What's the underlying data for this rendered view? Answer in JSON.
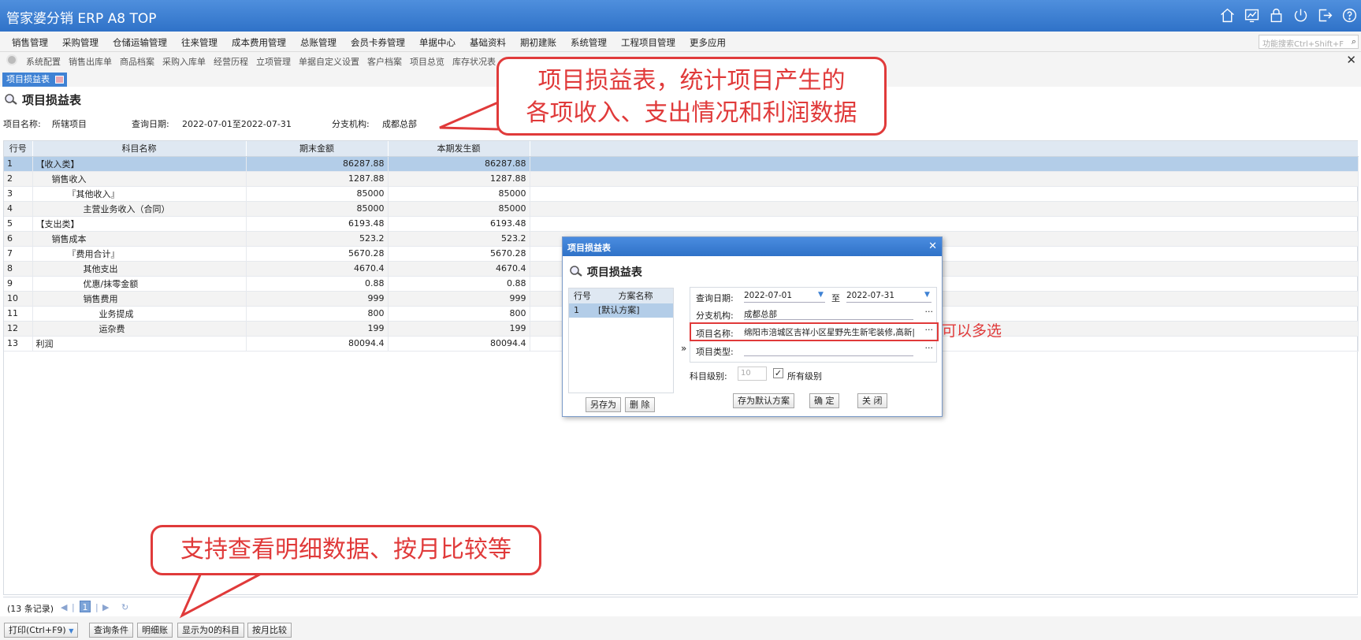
{
  "app": {
    "title": "管家婆分销 ERP A8 TOP"
  },
  "menu": [
    "销售管理",
    "采购管理",
    "仓储运输管理",
    "往来管理",
    "成本费用管理",
    "总账管理",
    "会员卡券管理",
    "单据中心",
    "基础资料",
    "期初建账",
    "系统管理",
    "工程项目管理",
    "更多应用"
  ],
  "function_search": {
    "placeholder": "功能搜索Ctrl+Shift+F"
  },
  "quick_links": [
    "系统配置",
    "销售出库单",
    "商品档案",
    "采购入库单",
    "经营历程",
    "立项管理",
    "单据自定义设置",
    "客户档案",
    "项目总览",
    "库存状况表"
  ],
  "tab": {
    "label": "项目损益表"
  },
  "page": {
    "title": "项目损益表"
  },
  "filters": {
    "project_label": "项目名称:",
    "project_value": "所辖项目",
    "date_label": "查询日期:",
    "date_value": "2022-07-01至2022-07-31",
    "branch_label": "分支机构:",
    "branch_value": "成都总部"
  },
  "table": {
    "headers": [
      "行号",
      "科目名称",
      "期末金额",
      "本期发生额"
    ],
    "rows": [
      {
        "no": "1",
        "name": "【收入类】",
        "end": "86287.88",
        "period": "86287.88"
      },
      {
        "no": "2",
        "name": "销售收入",
        "end": "1287.88",
        "period": "1287.88"
      },
      {
        "no": "3",
        "name": "『其他收入』",
        "end": "85000",
        "period": "85000"
      },
      {
        "no": "4",
        "name": "主营业务收入（合同）",
        "end": "85000",
        "period": "85000"
      },
      {
        "no": "5",
        "name": "【支出类】",
        "end": "6193.48",
        "period": "6193.48"
      },
      {
        "no": "6",
        "name": "销售成本",
        "end": "523.2",
        "period": "523.2"
      },
      {
        "no": "7",
        "name": "『费用合计』",
        "end": "5670.28",
        "period": "5670.28"
      },
      {
        "no": "8",
        "name": "其他支出",
        "end": "4670.4",
        "period": "4670.4"
      },
      {
        "no": "9",
        "name": "优惠/抹零金额",
        "end": "0.88",
        "period": "0.88"
      },
      {
        "no": "10",
        "name": "销售费用",
        "end": "999",
        "period": "999"
      },
      {
        "no": "11",
        "name": "业务提成",
        "end": "800",
        "period": "800"
      },
      {
        "no": "12",
        "name": "运杂费",
        "end": "199",
        "period": "199"
      },
      {
        "no": "13",
        "name": "利润",
        "end": "80094.4",
        "period": "80094.4"
      }
    ]
  },
  "pager": {
    "count": "(13 条记录)",
    "current_page": "1"
  },
  "bottom_buttons": {
    "print": "打印(Ctrl+F9)",
    "query": "查询条件",
    "detail": "明细账",
    "show_zero": "显示为0的科目",
    "monthly": "按月比较"
  },
  "callouts": {
    "top_line1": "项目损益表，统计项目产生的",
    "top_line2": "各项收入、支出情况和利润数据",
    "bottom": "支持查看明细数据、按月比较等",
    "multi": "可以多选"
  },
  "dialog": {
    "header": "项目损益表",
    "title": "项目损益表",
    "scheme_headers": [
      "行号",
      "方案名称"
    ],
    "scheme_rows": [
      {
        "no": "1",
        "name": "[默认方案]"
      }
    ],
    "arrow": "»",
    "date_label": "查询日期:",
    "date_from": "2022-07-01",
    "date_to_sep": "至",
    "date_to": "2022-07-31",
    "branch_label": "分支机构:",
    "branch_value": "成都总部",
    "project_label": "项目名称:",
    "project_value": "绵阳市涪城区吉祥小区星野先生新宅装修,高新|",
    "type_label": "项目类型:",
    "type_value": "",
    "level_label": "科目级别:",
    "level_value": "10",
    "all_levels_label": "所有级别",
    "ellipsis": "···",
    "buttons": {
      "save_as": "另存为",
      "delete": "删 除",
      "save_default": "存为默认方案",
      "ok": "确 定",
      "close": "关 闭"
    }
  },
  "colors": {
    "accent": "#2f72c8",
    "callout": "#e03a3a",
    "selected_row": "#b3cde8"
  }
}
